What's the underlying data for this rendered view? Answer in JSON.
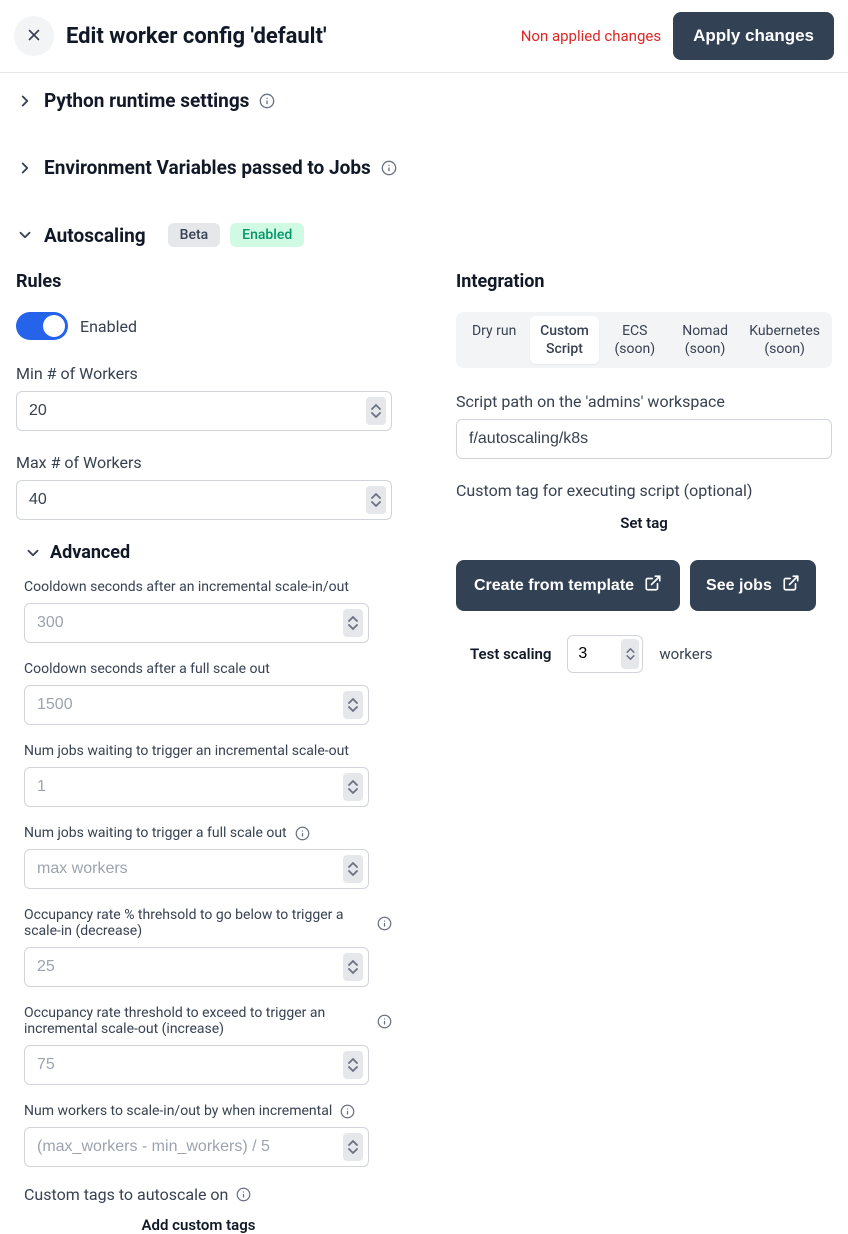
{
  "header": {
    "title": "Edit worker config 'default'",
    "non_applied": "Non applied changes",
    "apply": "Apply changes"
  },
  "sections": {
    "python": "Python runtime settings",
    "env": "Environment Variables passed to Jobs",
    "autoscaling": "Autoscaling",
    "badge_beta": "Beta",
    "badge_enabled": "Enabled"
  },
  "rules": {
    "title": "Rules",
    "enabled_label": "Enabled",
    "min_label": "Min # of Workers",
    "min_value": "20",
    "max_label": "Max # of Workers",
    "max_value": "40"
  },
  "advanced": {
    "title": "Advanced",
    "cooldown_inc_label": "Cooldown seconds after an incremental scale-in/out",
    "cooldown_inc_placeholder": "300",
    "cooldown_full_label": "Cooldown seconds after a full scale out",
    "cooldown_full_placeholder": "1500",
    "jobs_inc_label": "Num jobs waiting to trigger an incremental scale-out",
    "jobs_inc_placeholder": "1",
    "jobs_full_label": "Num jobs waiting to trigger a full scale out",
    "jobs_full_placeholder": "max workers",
    "occ_in_label": "Occupancy rate % threhsold to go below to trigger a scale-in (decrease)",
    "occ_in_placeholder": "25",
    "occ_out_label": "Occupancy rate threshold to exceed to trigger an incremental scale-out (increase)",
    "occ_out_placeholder": "75",
    "num_workers_label": "Num workers to scale-in/out by when incremental",
    "num_workers_placeholder": "(max_workers - min_workers) / 5",
    "custom_tags_label": "Custom tags to autoscale on",
    "add_tags": "Add custom tags"
  },
  "integration": {
    "title": "Integration",
    "tabs": {
      "dry": "Dry run",
      "custom": "Custom Script",
      "ecs": "ECS (soon)",
      "nomad": "Nomad (soon)",
      "k8s": "Kubernetes (soon)"
    },
    "script_label": "Script path on the 'admins' workspace",
    "script_value": "f/autoscaling/k8s",
    "tag_label": "Custom tag for executing script (optional)",
    "set_tag": "Set tag",
    "create_template": "Create from template",
    "see_jobs": "See jobs",
    "test_label": "Test scaling",
    "test_value": "3",
    "workers": "workers"
  }
}
